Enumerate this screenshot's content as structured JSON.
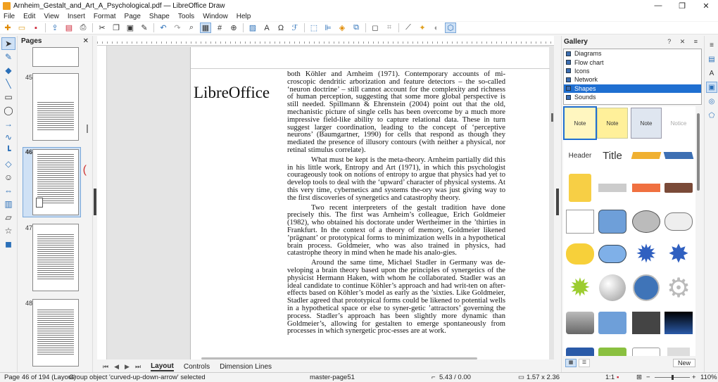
{
  "window": {
    "title": "Arnheim_Gestalt_and_Art_A_Psychological.pdf — LibreOffice Draw",
    "minimize": "—",
    "maximize": "❐",
    "close": "✕"
  },
  "menu": [
    "File",
    "Edit",
    "View",
    "Insert",
    "Format",
    "Page",
    "Shape",
    "Tools",
    "Window",
    "Help"
  ],
  "toolbar_icons": [
    "new-icon",
    "open-icon",
    "save-icon",
    "export-icon",
    "export-pdf-icon",
    "print-icon",
    "cut-icon",
    "copy-icon",
    "paste-icon",
    "clone-formatting-icon",
    "undo-icon",
    "redo-icon",
    "find-icon",
    "snap-grid-icon",
    "display-grid-icon",
    "helplines-icon",
    "zoom-icon",
    "image-icon",
    "textbox-icon",
    "special-character-icon",
    "fontwork-icon",
    "transform-icon",
    "align-icon",
    "arrange-icon",
    "select-at-three-objects-icon",
    "shadow-icon",
    "crop-icon",
    "points-icon",
    "glue-icon",
    "toggle-extrusion-icon",
    "show-draw-functions-icon"
  ],
  "pages_panel": {
    "title": "Pages",
    "close": "✕",
    "thumbs": [
      "45",
      "46",
      "47",
      "48"
    ]
  },
  "document": {
    "logo_text": "LibreOffice",
    "paragraphs": [
      "both Köhler and Arnheim (1971). Contemporary accounts of mi-croscopic dendritic arborization and feature detectors – the so-called ‘neuron doctrine’ – still cannot account for the complexity and richness of human perception, suggesting that some more global perspective is still needed. Spillmann & Ehrenstein (2004) point out that the old, mechanistic picture of single cells has been overcome by a much more impressive field-like ability to capture relational data. These in turn suggest larger coordination, leading to the concept of ‘perceptive neurons’ (Baumgartner, 1990) for cells that respond as though they mediated the presence of illusory contours (with neither a physical, nor retinal stimulus correlate).",
      "What must be kept is the meta-theory. Arnheim partially did this in his little work, Entropy and Art (1971), in which this psychologist courageously took on notions of entropy to argue that physics had yet to develop tools to deal with the ‘upward’ character of physical systems. At this very time, cybernetics and systems the-ory was just giving way to the first discoveries of synergetics and catastrophy theory.",
      "Two recent interpreters of the gestalt tradition have done precisely this. The first was Arnheim’s colleague, Erich Goldmeier (1982), who obtained his doctorate under Wertheimer in the ’thirties in Frankfurt. In the context of a theory of memory, Goldmeier likened ’prägnant’ or prototypical forms to minimization wells in a hypothetical brain process. Goldmeier, who was also trained in physics, had catastrophe theory in mind when he made his analo-gies.",
      "Around the same time, Michael Stadler in Germany was de-veloping a brain theory based upon the principles of synergetics of the physicist Hermann Haken, with whom he collaborated. Stadler was an ideal candidate to continue Köhler’s approach and had writ-ten on after-effects based on Köhler’s model as early as the ’sixties. Like Goldmeier, Stadler agreed that prototypical forms could be likened to potential wells in a hypothetical space or else to syner-getic ’attractors’ governing the process. Stadler’s approach has been slightly more dynamic than Goldmeier’s, allowing for gestalten to emerge spontaneously from processes in which synergetic proc-esses are at work."
    ]
  },
  "bottom_tabs": [
    "Layout",
    "Controls",
    "Dimension Lines"
  ],
  "gallery": {
    "title": "Gallery",
    "header_icons": "? ✕ ≡",
    "themes": [
      "Diagrams",
      "Flow chart",
      "Icons",
      "Network",
      "Shapes",
      "Sounds"
    ],
    "selected_theme": "Shapes",
    "shape_labels": [
      "Note",
      "Note",
      "Note",
      "Notice",
      "Header",
      "Title"
    ],
    "new_button": "New"
  },
  "status": {
    "page": "Page 46 of 194 (Layout)",
    "selection": "Group object 'curved-up-down-arrow' selected",
    "master": "master-page51",
    "position": "5.43 / 0.00",
    "size": "1.57 x 2.36",
    "scale": "1:1",
    "zoom": "110%"
  },
  "colors": {
    "accent": "#1f6fd1",
    "selection_bg": "#cfe1f5",
    "spellcheck": "#bb0000"
  }
}
